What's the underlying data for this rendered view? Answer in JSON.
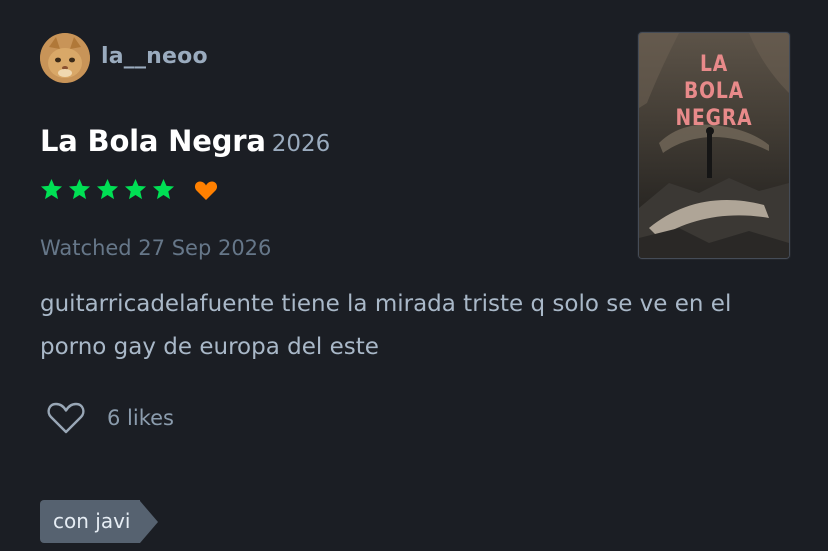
{
  "user": {
    "name": "la__neoo",
    "avatar_icon": "cat-avatar"
  },
  "film": {
    "title": "La Bola Negra",
    "year": "2026"
  },
  "rating": {
    "stars": 5,
    "max": 5,
    "liked": true,
    "star_color": "#00e054",
    "like_color": "#ff8000"
  },
  "watched": "Watched 27 Sep 2026",
  "review_text": "guitarricadelafuente tiene la mirada triste q solo se ve en el porno gay de europa del este",
  "likes": {
    "label": "6 likes",
    "icon": "heart-outline-icon"
  },
  "tag": {
    "label": "con javi"
  },
  "poster": {
    "title_lines": [
      "LA",
      "BOLA",
      "NEGRA"
    ]
  }
}
